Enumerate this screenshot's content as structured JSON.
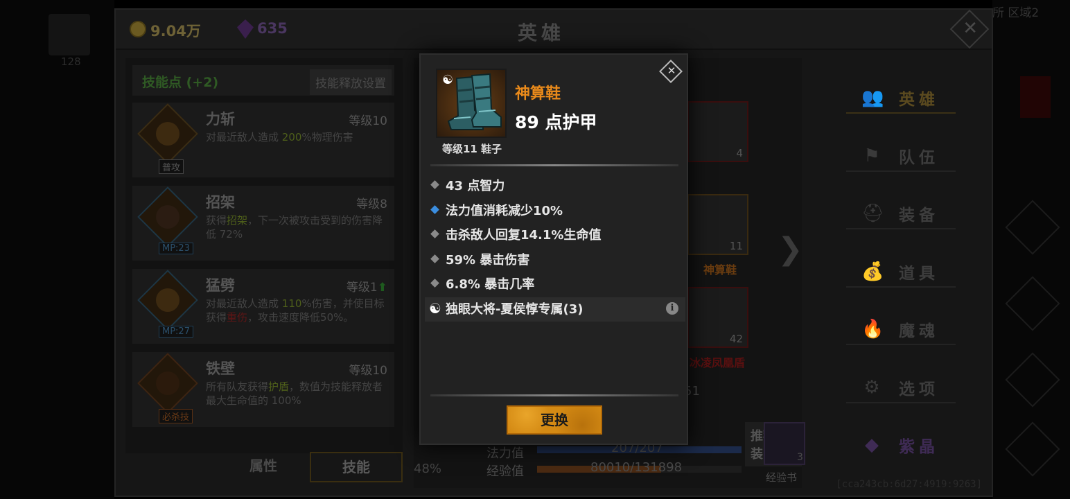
{
  "background": {
    "left_number": "128",
    "right_region_text": "所 区域2"
  },
  "header": {
    "gold_amount": "9.04万",
    "gem_amount": "635",
    "title": "英雄"
  },
  "skills_panel": {
    "skill_points_label": "技能点 (+2)",
    "release_settings_button": "技能释放设置",
    "skills": [
      {
        "name": "力斩",
        "level": "等级10",
        "tag": "普攻",
        "desc_pre": "对最近敌人造成 ",
        "desc_hl": "200",
        "desc_post": "%物理伤害",
        "tag_color": "#555555"
      },
      {
        "name": "招架",
        "level": "等级8",
        "tag": "MP:23",
        "desc_pre": "获得",
        "desc_hl": "招架",
        "desc_post": "，下一次被攻击受到的伤害降低 72%",
        "tag_color": "#1f3e55"
      },
      {
        "name": "猛劈",
        "level": "等级1",
        "tag": "MP:27",
        "desc_pre": "对最近敌人造成 ",
        "desc_hl": "110",
        "desc_post": "%伤害，并使目标获得",
        "desc_hl2": "重伤",
        "desc_post2": "，攻击速度降低50%。",
        "tag_color": "#1f3e55"
      },
      {
        "name": "铁壁",
        "level": "等级10",
        "tag": "必杀技",
        "desc_pre": "所有队友获得",
        "desc_hl": "护盾",
        "desc_post": "，数值为技能释放者最大生命值的 100%",
        "tag_color": "#5a3013"
      }
    ],
    "tabs": [
      "属性",
      "技能"
    ]
  },
  "equipment": {
    "slots": [
      {
        "count": "4"
      },
      {
        "count": "11",
        "name": "神算鞋"
      },
      {
        "count": "42",
        "name": "冰凌凤凰盾"
      }
    ],
    "recommend_button": "推荐配装",
    "partial_number": "51",
    "percent": "48%",
    "mana_label": "法力值",
    "mana_value": "207/207",
    "exp_label": "经验值",
    "exp_value": "80010/131898",
    "exp_progress": 0.607,
    "exp_book_label": "经验书",
    "exp_book_count": "3"
  },
  "nav": {
    "items": [
      {
        "label": "英雄",
        "icon": "users-icon",
        "state": "active"
      },
      {
        "label": "队伍",
        "icon": "flag-icon",
        "state": "normal"
      },
      {
        "label": "装备",
        "icon": "helmet-icon",
        "state": "normal"
      },
      {
        "label": "道具",
        "icon": "bag-icon",
        "state": "normal"
      },
      {
        "label": "魔魂",
        "icon": "fire-icon",
        "state": "normal"
      },
      {
        "label": "选项",
        "icon": "gear-icon",
        "state": "normal"
      },
      {
        "label": "紫晶",
        "icon": "gem-icon",
        "state": "purple"
      }
    ]
  },
  "debug_id": "[cca243cb:6d27:4919:9263]",
  "popup": {
    "item_name": "神算鞋",
    "main_stat": "89 点护甲",
    "meta": "等级11 鞋子",
    "stats": [
      {
        "text": "43 点智力",
        "bullet": "gray"
      },
      {
        "text": "法力值消耗减少10%",
        "bullet": "blue"
      },
      {
        "text": "击杀敌人回复14.1%生命值",
        "bullet": "gray"
      },
      {
        "text": "59% 暴击伤害",
        "bullet": "gray"
      },
      {
        "text": "6.8% 暴击几率",
        "bullet": "gray"
      }
    ],
    "set_bonus": "独眼大将-夏侯惇专属(3)",
    "swap_button": "更换",
    "colors": {
      "name": "#e98a1b",
      "button": "#d48a14",
      "blue_bullet": "#3b8ee0"
    }
  }
}
